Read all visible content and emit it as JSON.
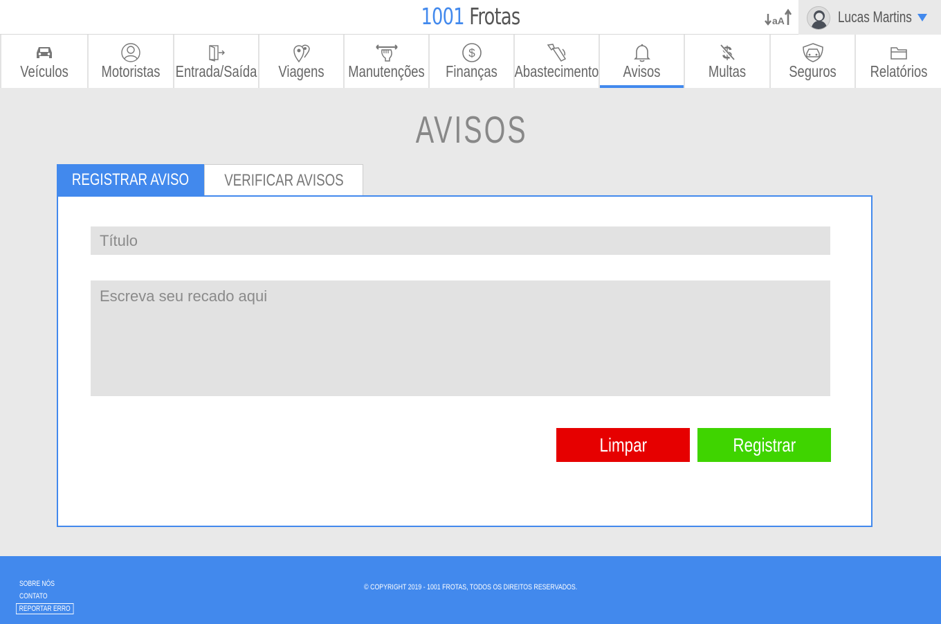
{
  "header": {
    "brand_number": "1001",
    "brand_name": "Frotas",
    "font_size_control": "aA",
    "user_name": "Lucas Martins"
  },
  "nav": {
    "items": [
      {
        "label": "Veículos",
        "icon": "car-icon"
      },
      {
        "label": "Motoristas",
        "icon": "driver-icon"
      },
      {
        "label": "Entrada/Saída",
        "icon": "door-exit-icon"
      },
      {
        "label": "Viagens",
        "icon": "map-pins-icon"
      },
      {
        "label": "Manutenções",
        "icon": "wrench-hand-icon"
      },
      {
        "label": "Finanças",
        "icon": "dollar-circle-icon"
      },
      {
        "label": "Abastecimento",
        "icon": "fuel-nozzle-icon"
      },
      {
        "label": "Avisos",
        "icon": "bell-icon"
      },
      {
        "label": "Multas",
        "icon": "dollar-strike-icon"
      },
      {
        "label": "Seguros",
        "icon": "insured-car-icon"
      },
      {
        "label": "Relatórios",
        "icon": "folder-icon"
      }
    ],
    "active": "Avisos"
  },
  "page": {
    "title": "AVISOS"
  },
  "tabs": {
    "register": "REGISTRAR AVISO",
    "verify": "VERIFICAR AVISOS",
    "active": "REGISTRAR AVISO"
  },
  "form": {
    "title_placeholder": "Título",
    "title_value": "",
    "message_placeholder": "Escreva seu recado aqui",
    "message_value": "",
    "clear_label": "Limpar",
    "register_label": "Registrar"
  },
  "footer": {
    "about": "SOBRE NÓS",
    "contact": "CONTATO",
    "report": "REPORTAR ERRO",
    "copyright": "© COPYRIGHT 2019 - 1001 FROTAS, TODOS OS DIREITOS RESERVADOS."
  },
  "colors": {
    "accent": "#4289ed",
    "clear_button": "#e60000",
    "register_button": "#3fd400",
    "background": "#e9e9e9"
  }
}
